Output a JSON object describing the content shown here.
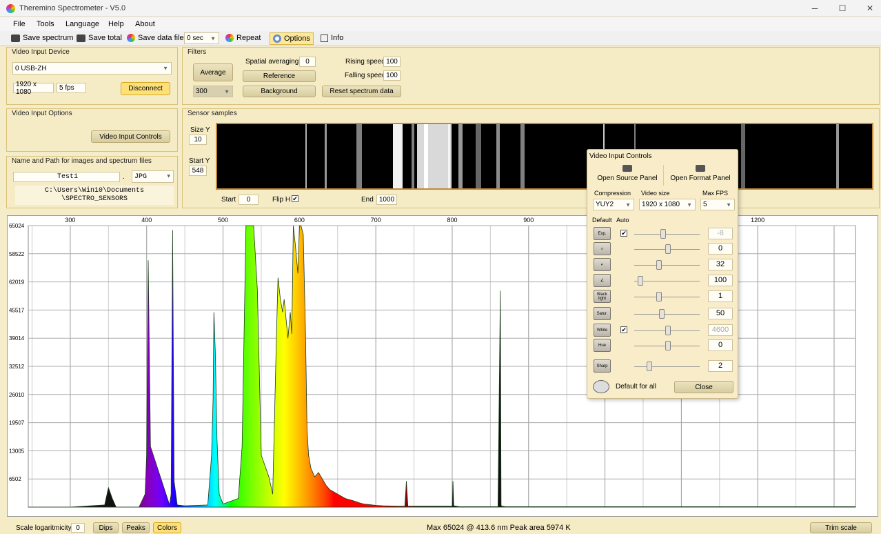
{
  "window": {
    "title": "Theremino Spectrometer - V5.0",
    "min": "─",
    "max": "☐",
    "close": "✕"
  },
  "menu": [
    "File",
    "Tools",
    "Language",
    "Help",
    "About"
  ],
  "toolbar": {
    "save_spectrum": "Save spectrum",
    "save_total": "Save total",
    "save_data_file": "Save data file",
    "interval": "0 sec",
    "repeat": "Repeat",
    "options": "Options",
    "info": "Info"
  },
  "video_input": {
    "title": "Video Input Device",
    "device": "0 USB-ZH",
    "resolution": "1920 x 1080",
    "fps": "5 fps",
    "disconnect": "Disconnect"
  },
  "video_options": {
    "title": "Video Input Options",
    "controls": "Video Input Controls"
  },
  "files": {
    "title": "Name and Path for images and spectrum files",
    "name": "Test1",
    "dot": ".",
    "ext": "JPG",
    "path1": "C:\\Users\\Win10\\Documents",
    "path2": "\\SPECTRO_SENSORS"
  },
  "filters": {
    "title": "Filters",
    "average": "Average",
    "avg_value": "300",
    "spatial_label": "Spatial averaging",
    "spatial_value": "0",
    "reference": "Reference",
    "background": "Background",
    "rising_label": "Rising speed",
    "rising_value": "100",
    "falling_label": "Falling speed",
    "falling_value": "100",
    "reset": "Reset spectrum data"
  },
  "sensor": {
    "title": "Sensor samples",
    "size_label": "Size Y",
    "size_value": "10",
    "start_label": "Start Y",
    "start_value": "548",
    "start_x_label": "Start",
    "start_x_value": "0",
    "flip_label": "Flip H",
    "flip_checked": "✔",
    "end_label": "End",
    "end_value": "1000"
  },
  "chart_data": {
    "type": "area",
    "x_ticks": [
      300,
      400,
      500,
      600,
      700,
      800,
      900,
      1000,
      1100,
      1200
    ],
    "x_tick_labels": [
      "300",
      "400",
      "500",
      "600",
      "700",
      "800",
      "900",
      "",
      "",
      "1200"
    ],
    "y_ticks": [
      6502,
      13005,
      19507,
      26010,
      32512,
      39014,
      45517,
      52019,
      58522,
      65024
    ],
    "y_tick_labels": [
      "6502",
      "13005",
      "19507",
      "26010",
      "32512",
      "39014",
      "45517",
      "62019",
      "58522",
      "65024"
    ],
    "xlim": [
      245,
      1328
    ],
    "ylim": [
      0,
      65024
    ],
    "x": [
      245,
      300,
      345,
      350,
      355,
      360,
      390,
      398,
      400,
      402,
      405,
      430,
      432,
      434,
      436,
      440,
      450,
      480,
      485,
      487,
      488,
      490,
      492,
      495,
      500,
      520,
      525,
      530,
      535,
      540,
      545,
      550,
      560,
      565,
      570,
      572,
      575,
      578,
      580,
      585,
      588,
      590,
      592,
      595,
      598,
      600,
      602,
      605,
      608,
      610,
      612,
      615,
      620,
      625,
      630,
      635,
      640,
      650,
      660,
      670,
      675,
      680,
      685,
      690,
      700,
      710,
      730,
      738,
      740,
      742,
      750,
      800,
      801,
      802,
      810,
      860,
      863,
      864,
      865,
      870,
      880,
      900,
      920,
      940,
      960,
      980,
      1000,
      1010,
      1020,
      1025,
      1030,
      1035,
      1040,
      1045,
      1050,
      1060,
      1080,
      1100,
      1150,
      1180,
      1190,
      1200,
      1210,
      1215,
      1230,
      1250,
      1300,
      1328
    ],
    "values": [
      0,
      0,
      500,
      4500,
      2000,
      0,
      0,
      3000,
      12000,
      57000,
      14000,
      500,
      3000,
      64000,
      6000,
      500,
      300,
      500,
      12000,
      25000,
      45000,
      35000,
      16000,
      3000,
      700,
      2000,
      14000,
      65024,
      65024,
      65024,
      50000,
      12000,
      7000,
      3000,
      40000,
      53000,
      48000,
      45000,
      48000,
      39000,
      45000,
      40000,
      65024,
      60000,
      54000,
      65024,
      65024,
      63000,
      40000,
      18000,
      12000,
      9000,
      7000,
      8000,
      6500,
      5000,
      4000,
      3000,
      2000,
      1500,
      1200,
      900,
      700,
      600,
      400,
      300,
      200,
      200,
      6000,
      200,
      200,
      200,
      6000,
      300,
      100,
      100,
      50000,
      400,
      200,
      100,
      100,
      100,
      100,
      100,
      100,
      100,
      100,
      100,
      100,
      100,
      100,
      100,
      100,
      100,
      100,
      100,
      100,
      100,
      100,
      100,
      100,
      100,
      100,
      100,
      100,
      100,
      100,
      100
    ]
  },
  "status": {
    "scale_label": "Scale logaritmicity",
    "scale_value": "0",
    "dips": "Dips",
    "peaks": "Peaks",
    "colors": "Colors",
    "info": "Max 65024 @ 413.6 nm  Peak area 5974 K",
    "trim": "Trim scale"
  },
  "vic": {
    "title": "Video Input Controls",
    "source": "Open Source Panel",
    "format": "Open Format Panel",
    "compression_label": "Compression",
    "compression": "YUY2",
    "size_label": "Video size",
    "size": "1920 x 1080",
    "fps_label": "Max FPS",
    "fps": "5",
    "default_label": "Default",
    "auto_label": "Auto",
    "rows": [
      {
        "icon": "Exp.",
        "auto": "✔",
        "value": "-8",
        "level": 0.42
      },
      {
        "icon": "☼",
        "auto": "",
        "value": "0",
        "level": 0.5
      },
      {
        "icon": "◐",
        "auto": "",
        "value": "32",
        "level": 0.35
      },
      {
        "icon": "∠",
        "auto": "",
        "value": "100",
        "level": 0.05
      },
      {
        "icon": "Black light",
        "auto": "",
        "value": "1",
        "level": 0.35
      },
      {
        "icon": "Satur.",
        "auto": "",
        "value": "50",
        "level": 0.4
      },
      {
        "icon": "White",
        "auto": "✔",
        "value": "4600",
        "level": 0.5
      },
      {
        "icon": "Hue",
        "auto": "",
        "value": "0",
        "level": 0.5
      },
      {
        "icon": "Sharp",
        "auto": "",
        "value": "2",
        "level": 0.2
      }
    ],
    "default_all": "Default for all",
    "close": "Close"
  }
}
